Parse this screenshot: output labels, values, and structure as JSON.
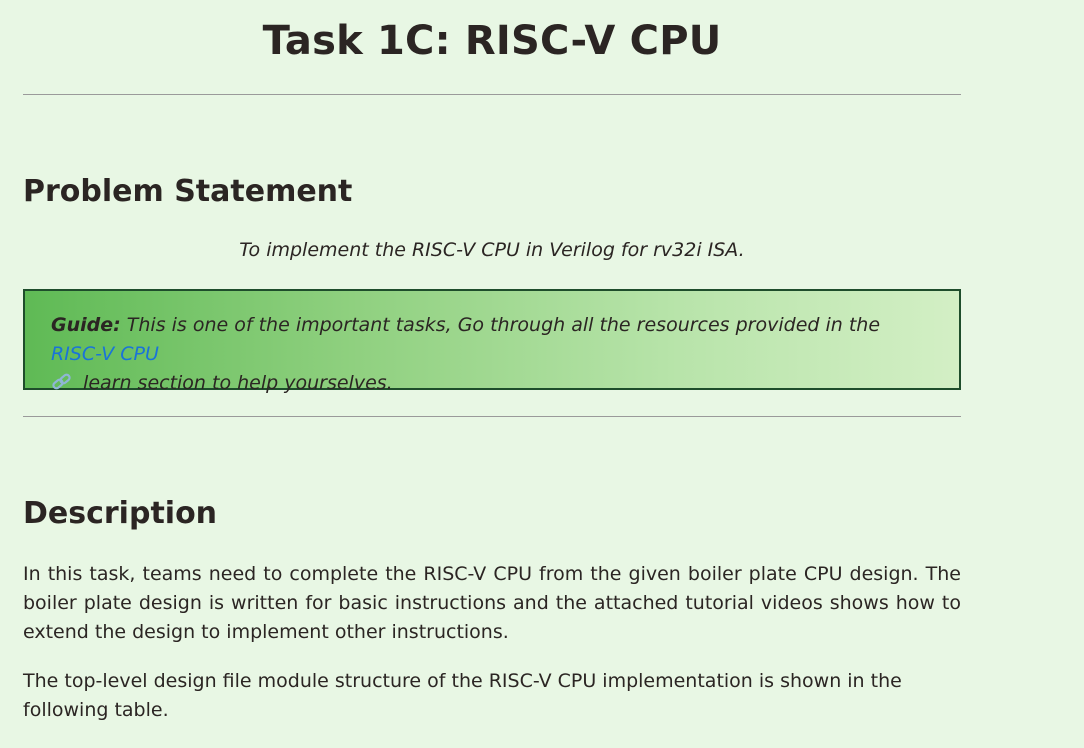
{
  "page": {
    "title": "Task 1C: RISC-V CPU"
  },
  "problem": {
    "heading": "Problem Statement",
    "statement": "To implement the RISC-V CPU in Verilog for rv32i ISA."
  },
  "guide": {
    "label": "Guide:",
    "text_before": " This is one of the important tasks, Go through all the resources provided in the ",
    "link_text": "RISC-V CPU",
    "text_after": " learn section to help yourselves.",
    "link_icon": "link-icon",
    "link_color": "#1a73d9"
  },
  "description": {
    "heading": "Description",
    "paragraph1": "In this task, teams need to complete the RISC-V CPU from the given boiler plate CPU design. The boiler plate design is written for basic instructions and the attached tutorial videos shows how to extend the design to implement other instructions.",
    "paragraph2": "The top-level design file module structure of the RISC-V CPU implementation is shown in the following table."
  },
  "colors": {
    "background": "#e8f7e4",
    "text": "#2b2523",
    "guide_border": "#1e4d2b"
  }
}
